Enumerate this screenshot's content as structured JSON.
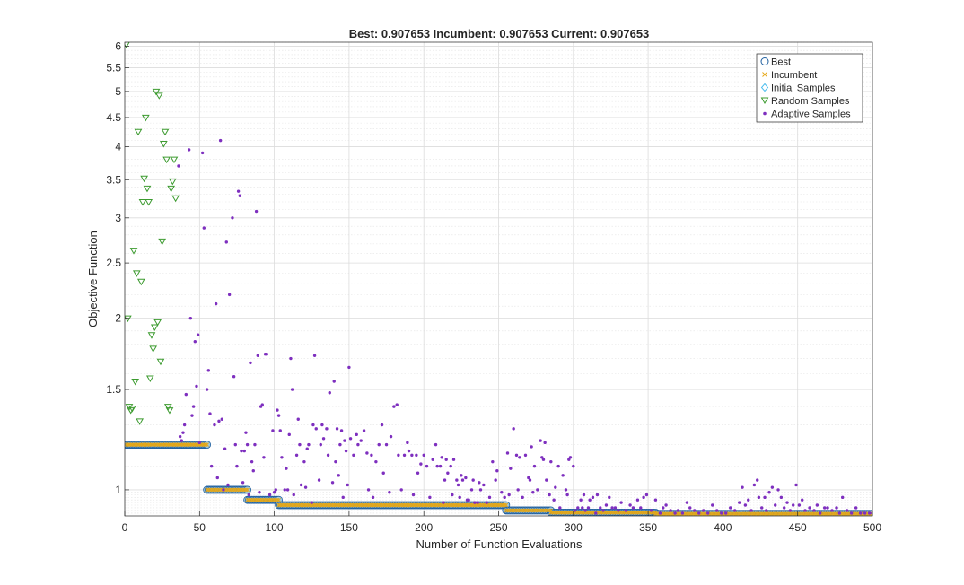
{
  "chart_data": {
    "type": "scatter",
    "title": "Best: 0.907653 Incumbent: 0.907653 Current: 0.907653",
    "xlabel": "Number of Function Evaluations",
    "ylabel": "Objective Function",
    "xlim": [
      0,
      500
    ],
    "ylim": [
      0.9,
      6.1
    ],
    "y_scale": "log",
    "grid": true,
    "minor_grid": true,
    "legend_position": "top-right",
    "x_ticks": [
      0,
      50,
      100,
      150,
      200,
      250,
      300,
      350,
      400,
      450,
      500
    ],
    "y_ticks": [
      1,
      1.5,
      2,
      2.5,
      3,
      3.5,
      4,
      4.5,
      5,
      5.5,
      6
    ],
    "legend": [
      "Best",
      "Incumbent",
      "Initial Samples",
      "Random Samples",
      "Adaptive Samples"
    ],
    "colors": {
      "best": "#1f5f9f",
      "best_fill": "#9fc7de",
      "incumbent": "#e6a817",
      "initial": "#4dbeee",
      "random": "#3c9b2f",
      "adaptive": "#7e2fbf"
    },
    "best_steps": [
      {
        "x": [
          0,
          55
        ],
        "y": 1.2
      },
      {
        "x": [
          55,
          82
        ],
        "y": 1.0
      },
      {
        "x": [
          82,
          103
        ],
        "y": 0.96
      },
      {
        "x": [
          103,
          255
        ],
        "y": 0.94
      },
      {
        "x": [
          255,
          285
        ],
        "y": 0.92
      },
      {
        "x": [
          285,
          355
        ],
        "y": 0.912
      },
      {
        "x": [
          355,
          500
        ],
        "y": 0.907653
      }
    ],
    "random_samples": [
      [
        1,
        6.05
      ],
      [
        2,
        2.0
      ],
      [
        3,
        1.4
      ],
      [
        4,
        1.38
      ],
      [
        5,
        1.39
      ],
      [
        6,
        2.63
      ],
      [
        7,
        1.55
      ],
      [
        8,
        2.4
      ],
      [
        9,
        4.25
      ],
      [
        10,
        1.32
      ],
      [
        11,
        2.32
      ],
      [
        12,
        3.2
      ],
      [
        13,
        3.52
      ],
      [
        14,
        4.5
      ],
      [
        15,
        3.38
      ],
      [
        16,
        3.2
      ],
      [
        17,
        1.57
      ],
      [
        18,
        1.87
      ],
      [
        19,
        1.77
      ],
      [
        20,
        1.93
      ],
      [
        21,
        5.0
      ],
      [
        22,
        1.97
      ],
      [
        23,
        4.92
      ],
      [
        24,
        1.68
      ],
      [
        25,
        2.73
      ],
      [
        26,
        4.05
      ],
      [
        27,
        4.25
      ],
      [
        28,
        3.8
      ],
      [
        29,
        1.4
      ],
      [
        30,
        1.38
      ],
      [
        31,
        3.38
      ],
      [
        32,
        3.48
      ],
      [
        33,
        3.8
      ],
      [
        34,
        3.25
      ]
    ],
    "adaptive_samples": [
      [
        36,
        3.7
      ],
      [
        37,
        1.24
      ],
      [
        38,
        1.22
      ],
      [
        39,
        1.26
      ],
      [
        40,
        1.3
      ],
      [
        41,
        1.47
      ],
      [
        43,
        3.95
      ],
      [
        44,
        2.0
      ],
      [
        45,
        1.35
      ],
      [
        46,
        1.4
      ],
      [
        47,
        1.82
      ],
      [
        48,
        1.52
      ],
      [
        49,
        1.87
      ],
      [
        50,
        1.21
      ],
      [
        52,
        3.9
      ],
      [
        53,
        2.88
      ],
      [
        55,
        1.5
      ],
      [
        56,
        1.62
      ],
      [
        57,
        1.36
      ],
      [
        58,
        1.1
      ],
      [
        60,
        1.3
      ],
      [
        61,
        2.12
      ],
      [
        62,
        1.05
      ],
      [
        63,
        1.32
      ],
      [
        64,
        4.1
      ],
      [
        65,
        1.33
      ],
      [
        66,
        1.0
      ],
      [
        67,
        1.18
      ],
      [
        68,
        2.72
      ],
      [
        69,
        1.02
      ],
      [
        70,
        2.2
      ],
      [
        72,
        3.0
      ],
      [
        73,
        1.58
      ],
      [
        74,
        1.2
      ],
      [
        75,
        1.1
      ],
      [
        76,
        3.34
      ],
      [
        77,
        3.28
      ],
      [
        78,
        1.17
      ],
      [
        79,
        1.03
      ],
      [
        80,
        1.17
      ],
      [
        81,
        1.26
      ],
      [
        82,
        1.2
      ],
      [
        83,
        0.98
      ],
      [
        84,
        1.67
      ],
      [
        85,
        1.12
      ],
      [
        86,
        1.08
      ],
      [
        87,
        1.2
      ],
      [
        88,
        3.08
      ],
      [
        89,
        1.72
      ],
      [
        90,
        0.99
      ],
      [
        91,
        1.4
      ],
      [
        92,
        1.41
      ],
      [
        93,
        1.14
      ],
      [
        94,
        1.73
      ],
      [
        95,
        1.73
      ],
      [
        97,
        0.98
      ],
      [
        99,
        1.27
      ],
      [
        100,
        0.99
      ],
      [
        101,
        1.0
      ],
      [
        102,
        1.38
      ],
      [
        103,
        1.35
      ],
      [
        104,
        1.27
      ],
      [
        105,
        1.14
      ],
      [
        107,
        1.0
      ],
      [
        108,
        1.09
      ],
      [
        109,
        1.0
      ],
      [
        110,
        1.25
      ],
      [
        111,
        1.7
      ],
      [
        112,
        1.5
      ],
      [
        113,
        0.98
      ],
      [
        115,
        1.15
      ],
      [
        116,
        1.33
      ],
      [
        117,
        1.2
      ],
      [
        118,
        1.02
      ],
      [
        120,
        1.12
      ],
      [
        121,
        1.01
      ],
      [
        122,
        1.18
      ],
      [
        123,
        1.2
      ],
      [
        125,
        0.95
      ],
      [
        126,
        1.3
      ],
      [
        127,
        1.72
      ],
      [
        128,
        1.28
      ],
      [
        130,
        1.04
      ],
      [
        131,
        1.2
      ],
      [
        132,
        1.3
      ],
      [
        133,
        1.23
      ],
      [
        135,
        1.28
      ],
      [
        136,
        1.15
      ],
      [
        137,
        1.48
      ],
      [
        139,
        1.03
      ],
      [
        140,
        1.55
      ],
      [
        141,
        1.12
      ],
      [
        142,
        1.28
      ],
      [
        143,
        1.06
      ],
      [
        144,
        1.2
      ],
      [
        145,
        1.27
      ],
      [
        146,
        0.97
      ],
      [
        147,
        1.22
      ],
      [
        148,
        1.17
      ],
      [
        149,
        1.02
      ],
      [
        150,
        1.64
      ],
      [
        151,
        1.23
      ],
      [
        153,
        1.15
      ],
      [
        155,
        1.25
      ],
      [
        156,
        1.2
      ],
      [
        158,
        1.22
      ],
      [
        160,
        1.27
      ],
      [
        162,
        1.16
      ],
      [
        163,
        1.0
      ],
      [
        165,
        1.15
      ],
      [
        166,
        0.97
      ],
      [
        168,
        1.12
      ],
      [
        170,
        1.2
      ],
      [
        172,
        1.3
      ],
      [
        173,
        1.07
      ],
      [
        175,
        1.2
      ],
      [
        177,
        0.99
      ],
      [
        178,
        1.24
      ],
      [
        180,
        1.4
      ],
      [
        182,
        1.41
      ],
      [
        183,
        1.15
      ],
      [
        185,
        1.0
      ],
      [
        187,
        1.15
      ],
      [
        189,
        1.21
      ],
      [
        190,
        1.17
      ],
      [
        192,
        1.15
      ],
      [
        193,
        0.98
      ],
      [
        195,
        1.15
      ],
      [
        196,
        1.07
      ],
      [
        198,
        1.11
      ],
      [
        200,
        1.15
      ],
      [
        202,
        1.1
      ],
      [
        204,
        0.97
      ],
      [
        206,
        1.13
      ],
      [
        208,
        1.2
      ],
      [
        209,
        1.1
      ],
      [
        211,
        1.1
      ],
      [
        212,
        1.14
      ],
      [
        213,
        0.95
      ],
      [
        214,
        1.04
      ],
      [
        215,
        1.13
      ],
      [
        216,
        1.07
      ],
      [
        218,
        1.1
      ],
      [
        219,
        0.98
      ],
      [
        220,
        1.13
      ],
      [
        222,
        1.04
      ],
      [
        223,
        1.02
      ],
      [
        224,
        0.97
      ],
      [
        225,
        1.06
      ],
      [
        226,
        1.04
      ],
      [
        228,
        1.05
      ],
      [
        229,
        0.96
      ],
      [
        230,
        0.96
      ],
      [
        232,
        1.0
      ],
      [
        233,
        1.04
      ],
      [
        234,
        0.95
      ],
      [
        236,
        0.95
      ],
      [
        237,
        1.03
      ],
      [
        238,
        1.0
      ],
      [
        240,
        1.02
      ],
      [
        242,
        0.95
      ],
      [
        244,
        0.97
      ],
      [
        246,
        1.12
      ],
      [
        248,
        1.04
      ],
      [
        249,
        1.08
      ],
      [
        252,
        0.99
      ],
      [
        254,
        0.97
      ],
      [
        256,
        1.16
      ],
      [
        257,
        0.98
      ],
      [
        258,
        1.09
      ],
      [
        260,
        1.28
      ],
      [
        262,
        1.15
      ],
      [
        263,
        1.0
      ],
      [
        264,
        1.14
      ],
      [
        266,
        0.97
      ],
      [
        268,
        1.15
      ],
      [
        270,
        1.05
      ],
      [
        271,
        1.04
      ],
      [
        272,
        1.19
      ],
      [
        273,
        0.99
      ],
      [
        274,
        1.1
      ],
      [
        276,
        1.0
      ],
      [
        278,
        1.22
      ],
      [
        279,
        1.14
      ],
      [
        280,
        1.13
      ],
      [
        281,
        1.21
      ],
      [
        282,
        1.04
      ],
      [
        284,
        0.98
      ],
      [
        285,
        1.12
      ],
      [
        287,
        0.96
      ],
      [
        288,
        1.01
      ],
      [
        290,
        1.1
      ],
      [
        291,
        0.93
      ],
      [
        293,
        1.06
      ],
      [
        295,
        1.0
      ],
      [
        296,
        0.98
      ],
      [
        297,
        1.13
      ],
      [
        298,
        1.14
      ],
      [
        300,
        1.1
      ],
      [
        301,
        0.92
      ],
      [
        303,
        0.93
      ],
      [
        305,
        0.96
      ],
      [
        306,
        0.93
      ],
      [
        307,
        0.98
      ],
      [
        308,
        0.92
      ],
      [
        310,
        0.93
      ],
      [
        311,
        0.96
      ],
      [
        313,
        0.97
      ],
      [
        315,
        0.91
      ],
      [
        316,
        0.98
      ],
      [
        318,
        0.93
      ],
      [
        320,
        0.92
      ],
      [
        322,
        0.94
      ],
      [
        324,
        0.97
      ],
      [
        326,
        0.93
      ],
      [
        328,
        0.93
      ],
      [
        330,
        0.92
      ],
      [
        332,
        0.95
      ],
      [
        335,
        0.92
      ],
      [
        338,
        0.94
      ],
      [
        340,
        0.93
      ],
      [
        343,
        0.96
      ],
      [
        345,
        0.93
      ],
      [
        347,
        0.97
      ],
      [
        349,
        0.98
      ],
      [
        352,
        0.92
      ],
      [
        355,
        0.96
      ],
      [
        358,
        0.91
      ],
      [
        360,
        0.93
      ],
      [
        362,
        0.94
      ],
      [
        365,
        0.92
      ],
      [
        368,
        0.91
      ],
      [
        370,
        0.92
      ],
      [
        373,
        0.91
      ],
      [
        376,
        0.95
      ],
      [
        378,
        0.93
      ],
      [
        381,
        0.92
      ],
      [
        384,
        0.91
      ],
      [
        387,
        0.92
      ],
      [
        390,
        0.91
      ],
      [
        393,
        0.94
      ],
      [
        396,
        0.92
      ],
      [
        399,
        0.91
      ],
      [
        402,
        0.91
      ],
      [
        405,
        0.93
      ],
      [
        408,
        0.92
      ],
      [
        411,
        0.95
      ],
      [
        413,
        1.01
      ],
      [
        415,
        0.94
      ],
      [
        417,
        0.96
      ],
      [
        419,
        0.92
      ],
      [
        421,
        1.02
      ],
      [
        423,
        1.04
      ],
      [
        424,
        0.97
      ],
      [
        426,
        0.93
      ],
      [
        428,
        0.97
      ],
      [
        429,
        0.92
      ],
      [
        431,
        0.99
      ],
      [
        433,
        1.01
      ],
      [
        435,
        0.94
      ],
      [
        437,
        1.0
      ],
      [
        439,
        0.97
      ],
      [
        441,
        0.93
      ],
      [
        443,
        0.95
      ],
      [
        445,
        0.92
      ],
      [
        447,
        0.94
      ],
      [
        449,
        1.02
      ],
      [
        451,
        0.94
      ],
      [
        453,
        0.96
      ],
      [
        455,
        0.92
      ],
      [
        458,
        0.93
      ],
      [
        461,
        0.92
      ],
      [
        463,
        0.94
      ],
      [
        465,
        0.91
      ],
      [
        468,
        0.93
      ],
      [
        470,
        0.93
      ],
      [
        473,
        0.92
      ],
      [
        476,
        0.93
      ],
      [
        478,
        0.91
      ],
      [
        480,
        0.97
      ],
      [
        483,
        0.92
      ],
      [
        486,
        0.91
      ],
      [
        489,
        0.93
      ],
      [
        492,
        0.91
      ],
      [
        495,
        0.91
      ],
      [
        498,
        0.91
      ],
      [
        500,
        0.91
      ]
    ]
  }
}
